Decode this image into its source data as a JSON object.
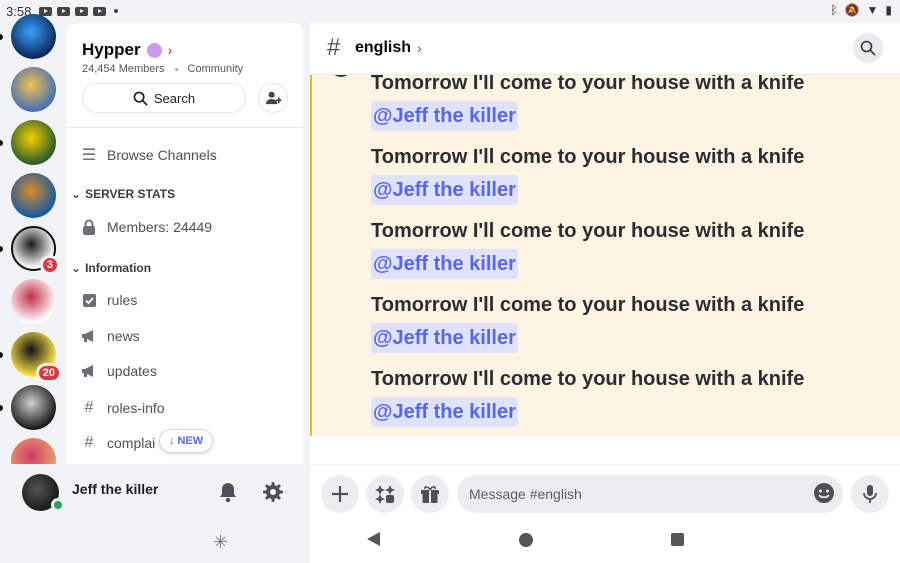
{
  "status_bar": {
    "time": "3:58"
  },
  "servers": [
    {
      "name": "server-1",
      "colors": [
        "#0b2a5c",
        "#3aa0ff"
      ],
      "badge": null,
      "pip": true
    },
    {
      "name": "server-2",
      "colors": [
        "#4a6fb5",
        "#f2c14e"
      ],
      "badge": null,
      "pip": false
    },
    {
      "name": "server-3",
      "colors": [
        "#2f5d2a",
        "#f5d000"
      ],
      "badge": null,
      "pip": true
    },
    {
      "name": "server-4",
      "colors": [
        "#1a5aa0",
        "#d98b2a"
      ],
      "badge": null,
      "pip": false
    },
    {
      "name": "server-5",
      "colors": [
        "#ffffff",
        "#1a1a1a"
      ],
      "badge": "3",
      "pip": true
    },
    {
      "name": "server-6",
      "colors": [
        "#ffffff",
        "#c0304a"
      ],
      "badge": null,
      "pip": false
    },
    {
      "name": "server-7",
      "colors": [
        "#ffe14a",
        "#111111"
      ],
      "badge": "20",
      "pip": true
    },
    {
      "name": "server-8",
      "colors": [
        "#1b1b1b",
        "#d0d0d0"
      ],
      "badge": null,
      "pip": true
    },
    {
      "name": "server-9",
      "colors": [
        "#e8a06a",
        "#d23a6a"
      ],
      "badge": null,
      "pip": false
    }
  ],
  "guild": {
    "name": "Hypper",
    "members": "24,454 Members",
    "tag": "Community",
    "search_label": "Search"
  },
  "channels": {
    "browse": "Browse Channels",
    "categories": [
      {
        "label": "SERVER STATS",
        "items": [
          {
            "label": "Members: 24449",
            "icon": "lock-icon"
          }
        ]
      },
      {
        "label": "Information",
        "items": [
          {
            "label": "rules",
            "icon": "rules-icon"
          },
          {
            "label": "news",
            "icon": "megaphone-icon"
          },
          {
            "label": "updates",
            "icon": "megaphone-icon"
          },
          {
            "label": "roles-info",
            "icon": "hash-icon"
          },
          {
            "label": "complai",
            "icon": "hash-icon"
          }
        ]
      }
    ],
    "new_pill": "NEW"
  },
  "user": {
    "name": "Jeff the killer",
    "status_color": "#23a55a"
  },
  "channel_header": {
    "name": "english"
  },
  "messages": [
    {
      "text": "Tomorrow I'll come to your house with a knife",
      "mention": "@Jeff the killer"
    },
    {
      "text": "Tomorrow I'll come to your house with a knife",
      "mention": "@Jeff the killer"
    },
    {
      "text": "Tomorrow I'll come to your house with a knife",
      "mention": "@Jeff the killer"
    },
    {
      "text": "Tomorrow I'll come to your house with a knife",
      "mention": "@Jeff the killer"
    },
    {
      "text": "Tomorrow I'll come to your house with a knife",
      "mention": "@Jeff the killer"
    }
  ],
  "composer": {
    "placeholder": "Message #english"
  },
  "colors": {
    "accent": "#5865f2",
    "mention_bg": "#e0e3ff",
    "highlight_bg": "#fdf4e3",
    "highlight_border": "#f0b232",
    "badge": "#da373c"
  }
}
